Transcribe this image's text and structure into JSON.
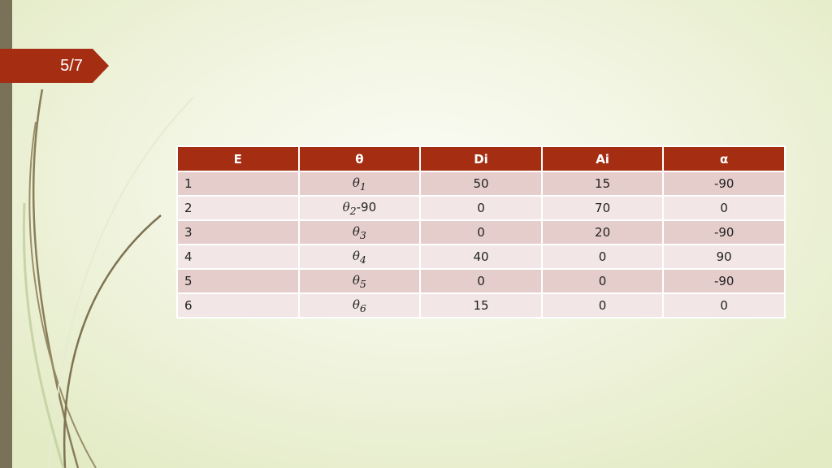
{
  "slide": {
    "number_label": "5/7"
  },
  "colors": {
    "accent": "#a52d12",
    "row_odd": "#e5cdcc",
    "row_even": "#f2e6e6",
    "left_bar": "#7a7258"
  },
  "table": {
    "headers": [
      "E",
      "θ",
      "Di",
      "Ai",
      "α"
    ],
    "rows": [
      {
        "e": "1",
        "theta": "θ",
        "theta_sub": "1",
        "theta_suffix": "",
        "di": "50",
        "ai": "15",
        "alpha": "-90"
      },
      {
        "e": "2",
        "theta": "θ",
        "theta_sub": "2",
        "theta_suffix": "-90",
        "di": "0",
        "ai": "70",
        "alpha": "0"
      },
      {
        "e": "3",
        "theta": "θ",
        "theta_sub": "3",
        "theta_suffix": "",
        "di": "0",
        "ai": "20",
        "alpha": "-90"
      },
      {
        "e": "4",
        "theta": "θ",
        "theta_sub": "4",
        "theta_suffix": "",
        "di": "40",
        "ai": "0",
        "alpha": "90"
      },
      {
        "e": "5",
        "theta": "θ",
        "theta_sub": "5",
        "theta_suffix": "",
        "di": "0",
        "ai": "0",
        "alpha": "-90"
      },
      {
        "e": "6",
        "theta": "θ",
        "theta_sub": "6",
        "theta_suffix": "",
        "di": "15",
        "ai": "0",
        "alpha": "0"
      }
    ]
  }
}
